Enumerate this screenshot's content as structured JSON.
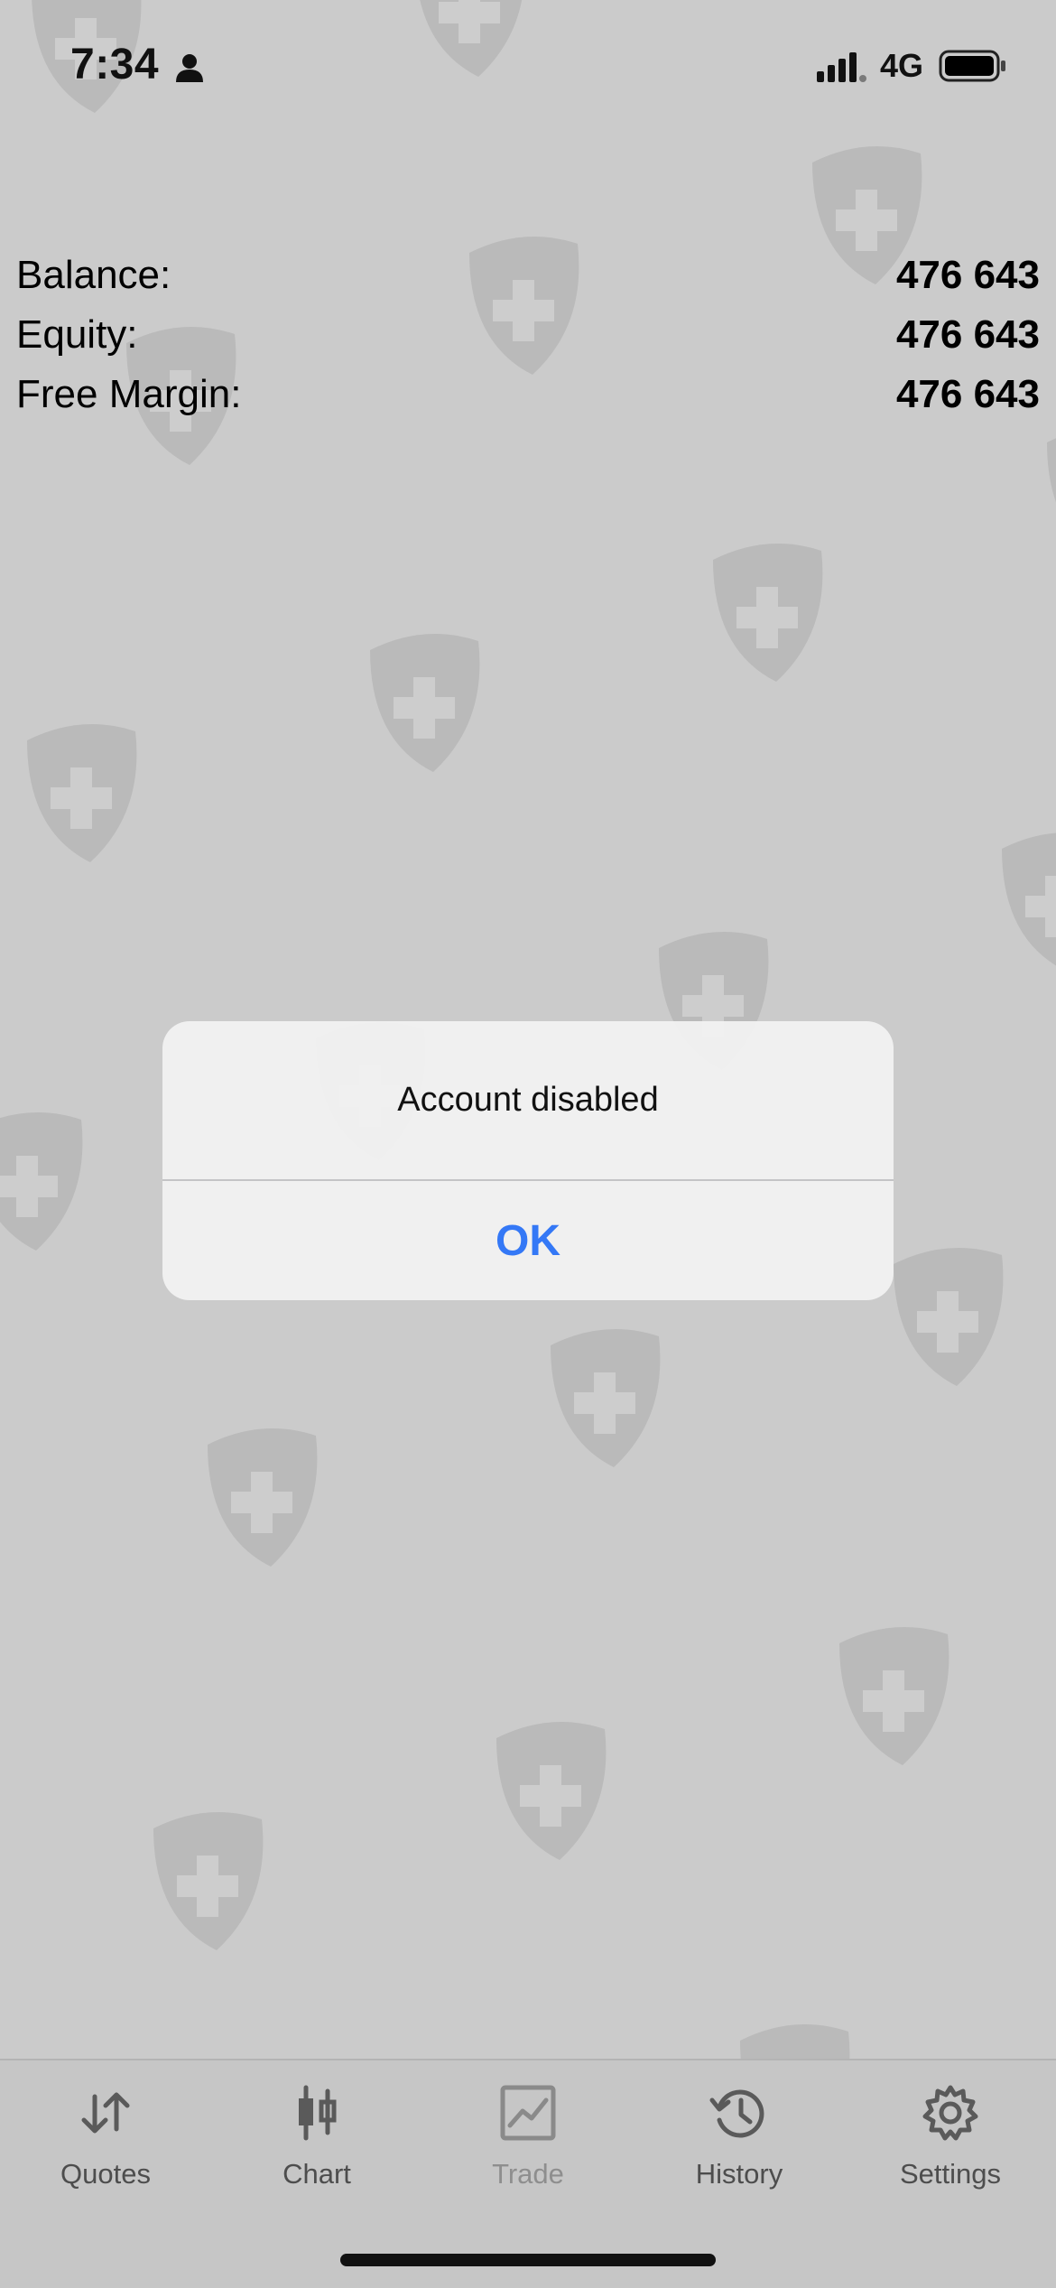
{
  "status_bar": {
    "time": "7:34",
    "network": "4G",
    "icons": [
      "person-icon",
      "signal-icon",
      "battery-icon"
    ]
  },
  "summary": {
    "rows": [
      {
        "label": "Balance:",
        "value": "476 643"
      },
      {
        "label": "Equity:",
        "value": "476 643"
      },
      {
        "label": "Free Margin:",
        "value": "476 643"
      }
    ]
  },
  "dialog": {
    "message": "Account disabled",
    "ok_label": "OK"
  },
  "tab_bar": {
    "tabs": [
      {
        "label": "Quotes",
        "icon": "quotes-arrows-icon",
        "enabled": true
      },
      {
        "label": "Chart",
        "icon": "candlestick-icon",
        "enabled": true
      },
      {
        "label": "Trade",
        "icon": "trade-chart-icon",
        "enabled": false
      },
      {
        "label": "History",
        "icon": "history-clock-icon",
        "enabled": true
      },
      {
        "label": "Settings",
        "icon": "gear-icon",
        "enabled": true
      }
    ]
  },
  "colors": {
    "background": "#cbcbcb",
    "accent": "#3478f6",
    "watermark": "#b9b9b9"
  }
}
